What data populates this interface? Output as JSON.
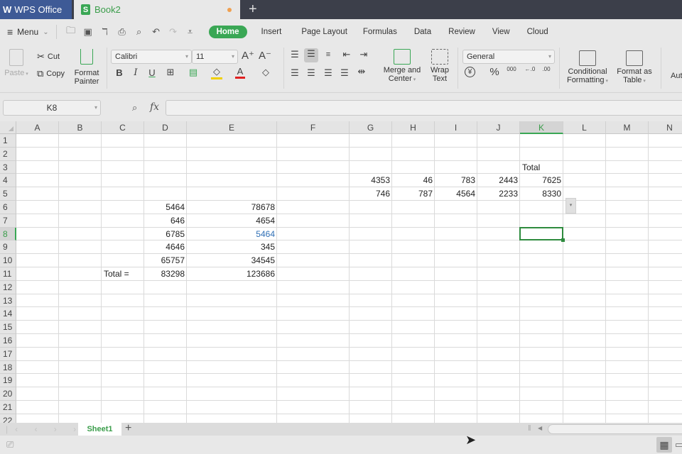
{
  "titlebar": {
    "app_tab": "WPS Office",
    "app_logo": "W",
    "doc_tab": "Book2",
    "doc_icon": "S",
    "unsaved_indicator": "•",
    "new_tab_icon": "+"
  },
  "menubar": {
    "menu_label": "Menu",
    "menu_icon": "≡",
    "chevron_icon": "⌄",
    "quick_access": [
      {
        "name": "open-icon",
        "glyph": "🗁"
      },
      {
        "name": "save-icon",
        "glyph": "🖫"
      },
      {
        "name": "format-painter-qa-icon",
        "glyph": "⚲"
      },
      {
        "name": "print-icon",
        "glyph": "⎙"
      },
      {
        "name": "print-preview-icon",
        "glyph": "🔍"
      },
      {
        "name": "undo-icon",
        "glyph": "↶"
      },
      {
        "name": "redo-icon",
        "glyph": "↷"
      },
      {
        "name": "customize-icon",
        "glyph": "⩡"
      }
    ],
    "tabs": [
      "Home",
      "Insert",
      "Page Layout",
      "Formulas",
      "Data",
      "Review",
      "View",
      "Cloud"
    ],
    "active_tab": "Home"
  },
  "ribbon": {
    "paste": "Paste",
    "cut": "Cut",
    "copy": "Copy",
    "format_painter_1": "Format",
    "format_painter_2": "Painter",
    "font_name": "Calibri",
    "font_size": "11",
    "increase_font": "A⁺",
    "decrease_font": "A⁻",
    "bold": "B",
    "italic": "I",
    "underline": "U",
    "merge_1": "Merge and",
    "merge_2": "Center",
    "wrap_1": "Wrap",
    "wrap_2": "Text",
    "number_format": "General",
    "currency": "¥",
    "percent": "%",
    "thousands": "000",
    "inc_decimal": "←.0",
    "dec_decimal": ".00",
    "cond_fmt_1": "Conditional",
    "cond_fmt_2": "Formatting",
    "fmt_table_1": "Format as",
    "fmt_table_2": "Table",
    "autosum_partial": "Aut"
  },
  "formulabar": {
    "name_box": "K8",
    "fx_label": "fx",
    "formula": ""
  },
  "grid": {
    "columns": [
      "A",
      "B",
      "C",
      "D",
      "E",
      "F",
      "G",
      "H",
      "I",
      "J",
      "K",
      "L",
      "M",
      "N"
    ],
    "rows": [
      "1",
      "2",
      "3",
      "4",
      "5",
      "6",
      "7",
      "8",
      "9",
      "10",
      "11",
      "12",
      "13",
      "14",
      "15",
      "16",
      "17",
      "18",
      "19",
      "20",
      "21",
      "22"
    ],
    "selected_cell": "K8",
    "cells": {
      "K3": "Total",
      "G4": "4353",
      "H4": "46",
      "I4": "783",
      "J4": "2443",
      "K4": "7625",
      "G5": "746",
      "H5": "787",
      "I5": "4564",
      "J5": "2233",
      "K5": "8330",
      "D6": "5464",
      "E6": "78678",
      "D7": "646",
      "E7": "4654",
      "D8": "6785",
      "E8": "5464",
      "D9": "4646",
      "E9": "345",
      "D10": "65757",
      "E10": "34545",
      "C11": "Total =",
      "D11": "83298",
      "E11": "123686"
    }
  },
  "sheets": {
    "tabs": [
      "Sheet1"
    ],
    "active": "Sheet1",
    "add_icon": "+",
    "nav": "⏮ ‹ › ⏭"
  },
  "statusbar": {
    "normal_view_icon": "▦",
    "page_view_icon": "▭"
  }
}
